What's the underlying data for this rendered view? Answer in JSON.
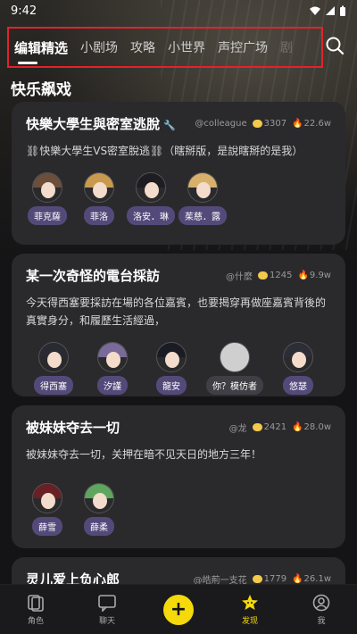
{
  "status": {
    "time": "9:42"
  },
  "tabs": [
    {
      "label": "编辑精选",
      "active": true
    },
    {
      "label": "小剧场"
    },
    {
      "label": "攻略"
    },
    {
      "label": "小世界"
    },
    {
      "label": "声控广场"
    },
    {
      "label": "剧"
    }
  ],
  "section_title": "快乐飙戏",
  "cards": [
    {
      "title": "快樂大學生與密室逃脫",
      "author": "@colleague",
      "chats": "3307",
      "heat": "22.6w",
      "desc": "⛓快樂大學生VS密室脫逃⛓（瞎掰版，是說瞎掰的是我）",
      "chars": [
        {
          "name": "菲克薩",
          "hair": "#6b4f3a"
        },
        {
          "name": "菲洛",
          "hair": "#c99a4e"
        },
        {
          "name": "洛安．琳",
          "hair": "#1d1d22"
        },
        {
          "name": "茱慈．露",
          "hair": "#d7b06c"
        }
      ]
    },
    {
      "title": "某一次奇怪的電台採訪",
      "author": "@什麼",
      "chats": "1245",
      "heat": "9.9w",
      "desc": "今天得西塞要採訪在場的各位嘉賓，也要揭穿再做座嘉賓背後的真實身分，和履歷生活經過，",
      "chars": [
        {
          "name": "得西塞",
          "hair": "#2a2a33"
        },
        {
          "name": "汐謹",
          "hair": "#7a6a9a"
        },
        {
          "name": "龍安",
          "hair": "#1b1b25"
        },
        {
          "name": "你？模仿者",
          "hair": "#cfcfcf",
          "gray": true
        },
        {
          "name": "悠瑟",
          "hair": "#2d2d38"
        }
      ]
    },
    {
      "title": "被妹妹夺去一切",
      "author": "@龙",
      "chats": "2421",
      "heat": "28.0w",
      "desc": "被妹妹夺去一切，关押在暗不见天日的地方三年！",
      "chars": [
        {
          "name": "薛雪",
          "hair": "#6a1f25"
        },
        {
          "name": "薛柔",
          "hair": "#5ea65e"
        }
      ]
    },
    {
      "title": "灵儿爱上负心郎",
      "author": "@皓荊一支花",
      "chats": "1779",
      "heat": "26.1w"
    }
  ],
  "nav": [
    {
      "label": "角色",
      "icon": "role-icon"
    },
    {
      "label": "聊天",
      "icon": "chat-icon"
    },
    {
      "label": "",
      "icon": "add-icon"
    },
    {
      "label": "发现",
      "icon": "discover-icon",
      "active": true
    },
    {
      "label": "我",
      "icon": "profile-icon"
    }
  ],
  "colors": {
    "accent": "#f5d90a",
    "highlight_box": "#e3222c",
    "chip": "#544a7a"
  }
}
